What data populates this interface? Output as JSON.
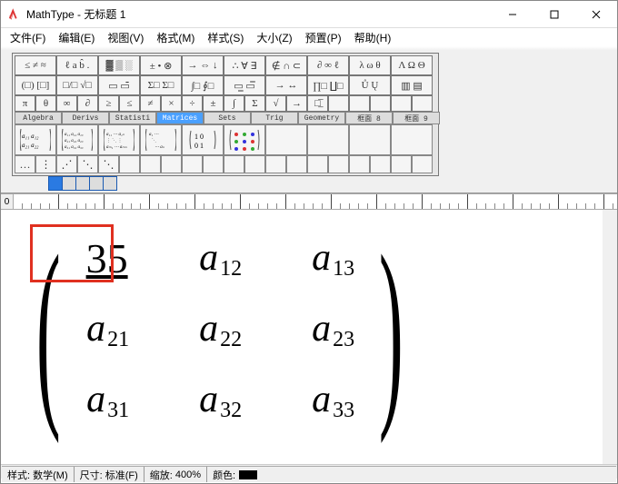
{
  "window": {
    "app": "MathType",
    "doc": "无标题 1",
    "title": "MathType - 无标题 1"
  },
  "menu": {
    "file": "文件(F)",
    "edit": "编辑(E)",
    "view": "视图(V)",
    "format": "格式(M)",
    "style": "样式(S)",
    "size": "大小(Z)",
    "preset": "预置(P)",
    "help": "帮助(H)"
  },
  "palette_rows": {
    "r1": [
      "≤ ≠ ≈",
      "ℓ a b̂ .",
      "▓ ▒ ░",
      "± • ⊗",
      "→ ⇔ ↓",
      "∴ ∀ ∃",
      "∉ ∩ ⊂",
      "∂ ∞ ℓ",
      "λ ω θ",
      "Λ Ω Θ"
    ],
    "r2": [
      "(□) [□]",
      "□/□ √□",
      "▭ ▭̄",
      "Σ□ Σ□",
      "∫□ ∮□",
      "▭̲ ▭̅",
      "→ ↔",
      "∏□ ∐□",
      "Ů Ų",
      "▥ ▤"
    ],
    "r3": [
      "π",
      "θ",
      "∞",
      "∂",
      "≥",
      "≤",
      "≠",
      "×",
      "÷",
      "±",
      "∫",
      "Σ",
      "√",
      "→",
      "□̲̅"
    ]
  },
  "palette_tabs": [
    "Algebra",
    "Derivs",
    "Statisti",
    "Matrices",
    "Sets",
    "Trig",
    "Geometry",
    "框面 8",
    "框面 9"
  ],
  "palette_tabs_selected": 3,
  "matrix_templates": [
    "2x2 a",
    "3x3 a",
    "3x3 …",
    "3x3 ⋱",
    "I 2x2",
    "3x3 rgb"
  ],
  "misc_buttons": [
    "…",
    "⋮",
    "⋰",
    "⋱",
    "⋱"
  ],
  "ruler_zero": "0",
  "equation": {
    "rows": 3,
    "cols": 3,
    "cells": [
      [
        "35",
        "a_12",
        "a_13"
      ],
      [
        "a_21",
        "a_22",
        "a_23"
      ],
      [
        "a_31",
        "a_32",
        "a_33"
      ]
    ],
    "highlight": {
      "row": 0,
      "col": 0
    }
  },
  "status": {
    "style_label": "样式:",
    "style_value": "数学(M)",
    "size_label": "尺寸:",
    "size_value": "标准(F)",
    "zoom_label": "缩放:",
    "zoom_value": "400%",
    "color_label": "颜色:",
    "color_value": "#000000"
  }
}
